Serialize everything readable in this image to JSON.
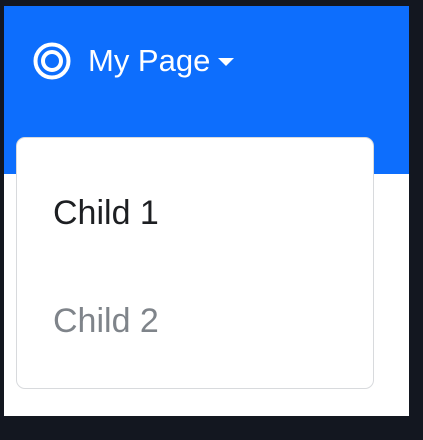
{
  "navbar": {
    "background_color": "#0d6efd",
    "brand_label": "My Page",
    "brand_icon": "target-icon",
    "caret_icon": "caret-down-icon"
  },
  "dropdown": {
    "items": [
      {
        "label": "Child 1",
        "state": "normal"
      },
      {
        "label": "Child 2",
        "state": "muted"
      }
    ]
  }
}
